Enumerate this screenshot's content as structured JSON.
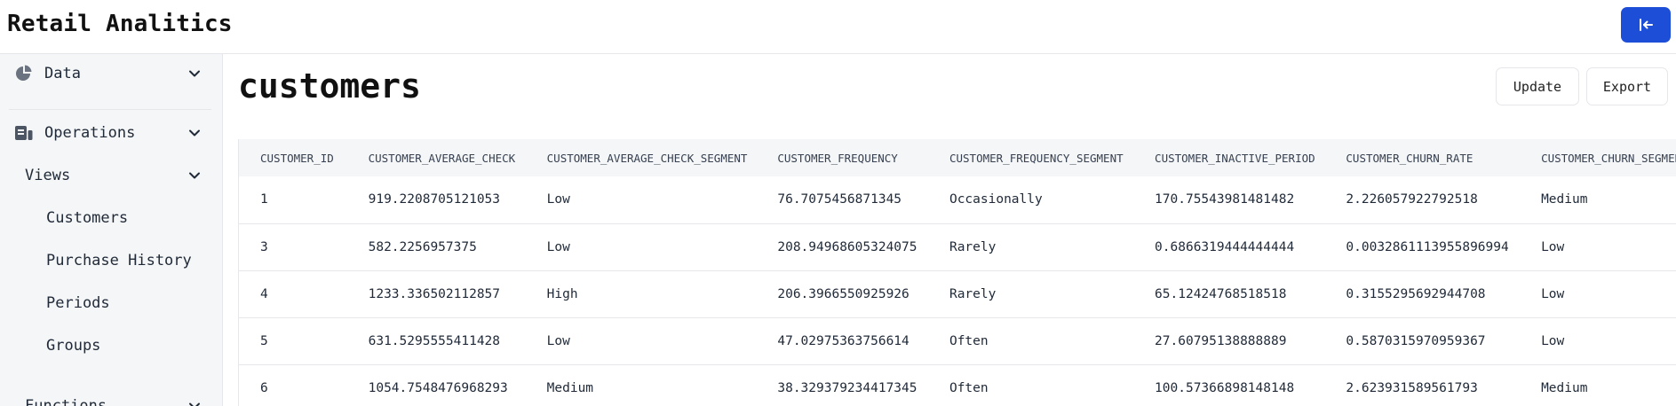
{
  "app": {
    "title": "Retail Analitics"
  },
  "sidebar": {
    "items": [
      {
        "label": "Data"
      },
      {
        "label": "Operations"
      },
      {
        "label": "Views"
      },
      {
        "label": "Customers"
      },
      {
        "label": "Purchase History"
      },
      {
        "label": "Periods"
      },
      {
        "label": "Groups"
      },
      {
        "label": "Functions"
      }
    ]
  },
  "main": {
    "title": "customers",
    "update_label": "Update",
    "export_label": "Export"
  },
  "table": {
    "columns": [
      "CUSTOMER_ID",
      "CUSTOMER_AVERAGE_CHECK",
      "CUSTOMER_AVERAGE_CHECK_SEGMENT",
      "CUSTOMER_FREQUENCY",
      "CUSTOMER_FREQUENCY_SEGMENT",
      "CUSTOMER_INACTIVE_PERIOD",
      "CUSTOMER_CHURN_RATE",
      "CUSTOMER_CHURN_SEGMENT"
    ],
    "rows": [
      [
        "1",
        "919.2208705121053",
        "Low",
        "76.7075456871345",
        "Occasionally",
        "170.75543981481482",
        "2.226057922792518",
        "Medium"
      ],
      [
        "3",
        "582.2256957375",
        "Low",
        "208.94968605324075",
        "Rarely",
        "0.6866319444444444",
        "0.0032861113955896994",
        "Low"
      ],
      [
        "4",
        "1233.336502112857",
        "High",
        "206.3966550925926",
        "Rarely",
        "65.12424768518518",
        "0.3155295692944708",
        "Low"
      ],
      [
        "5",
        "631.5295555411428",
        "Low",
        "47.02975363756614",
        "Often",
        "27.60795138888889",
        "0.5870315970959367",
        "Low"
      ],
      [
        "6",
        "1054.7548476968293",
        "Medium",
        "38.329379234417345",
        "Often",
        "100.57366898148148",
        "2.623931589561793",
        "Medium"
      ]
    ]
  }
}
